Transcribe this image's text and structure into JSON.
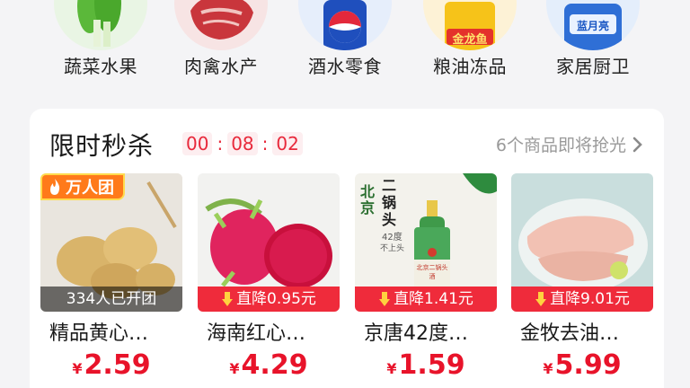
{
  "categories": [
    {
      "label": "蔬菜水果",
      "icon": "vegetable-icon"
    },
    {
      "label": "肉禽水产",
      "icon": "meat-icon"
    },
    {
      "label": "酒水零食",
      "icon": "soda-can-icon"
    },
    {
      "label": "粮油冻品",
      "icon": "oil-bottle-icon",
      "brand_text": "金龙鱼"
    },
    {
      "label": "家居厨卫",
      "icon": "detergent-icon",
      "brand_text": "蓝月亮"
    }
  ],
  "flash_sale": {
    "title": "限时秒杀",
    "timer": {
      "hours": "00",
      "minutes": "08",
      "seconds": "02",
      "separator": ":"
    },
    "more_text": "6个商品即将抢光",
    "colors": {
      "accent": "#e8132a",
      "tag_red": "#ef2b3b",
      "tag_orange": "#ff7a1a"
    }
  },
  "products": [
    {
      "name": "精品黄心…",
      "price": "2.59",
      "currency": "¥",
      "top_tag": "万人团",
      "bottom_tag": "334人已开团",
      "image": "potato"
    },
    {
      "name": "海南红心…",
      "price": "4.29",
      "currency": "¥",
      "bottom_tag": "直降0.95元",
      "image": "dragon-fruit"
    },
    {
      "name": "京唐42度…",
      "price": "1.59",
      "currency": "¥",
      "bottom_tag": "直降1.41元",
      "image": "erguotou-bottle",
      "package_text": {
        "left": "北京",
        "right": "二锅头",
        "degree": "42度",
        "note": "不上头",
        "label": "北京二锅头酒"
      }
    },
    {
      "name": "金牧去油…",
      "price": "5.99",
      "currency": "¥",
      "bottom_tag": "直降9.01元",
      "image": "chicken-breast"
    }
  ]
}
